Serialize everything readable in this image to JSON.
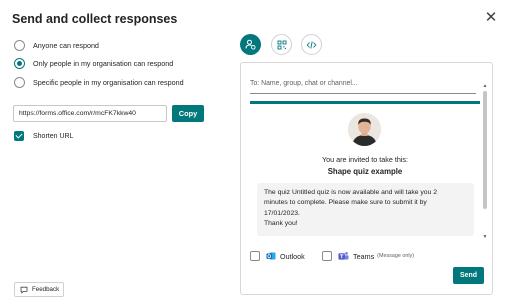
{
  "dialog": {
    "title": "Send and collect responses",
    "close_symbol": "✕"
  },
  "permissions": {
    "options": [
      {
        "label": "Anyone can respond",
        "checked": false
      },
      {
        "label": "Only people in my organisation can respond",
        "checked": true
      },
      {
        "label": "Specific people in my organisation can respond",
        "checked": false
      }
    ]
  },
  "link": {
    "url": "https://forms.office.com/r/mcFK7kkw40",
    "copy_label": "Copy",
    "shorten_label": "Shorten URL",
    "shorten_checked": true
  },
  "tabs": [
    {
      "icon": "person-link-icon",
      "active": true
    },
    {
      "icon": "qr-code-icon",
      "active": false
    },
    {
      "icon": "embed-code-icon",
      "active": false
    }
  ],
  "email": {
    "to_placeholder": "To: Name, group, chat or channel...",
    "invited_text": "You are invited to take this:",
    "quiz_name": "Shape quiz example",
    "message_lines": [
      "The quiz Untitled quiz is now available and will take you 2",
      "minutes to complete. Please make sure to submit it by",
      "17/01/2023.",
      "Thank you!"
    ],
    "outlook_label": "Outlook",
    "teams_label": "Teams",
    "teams_sub": "(Message only)",
    "send_label": "Send"
  },
  "feedback": {
    "label": "Feedback"
  },
  "colors": {
    "accent": "#03787c",
    "text": "#242424",
    "border": "#d1d1d1"
  }
}
